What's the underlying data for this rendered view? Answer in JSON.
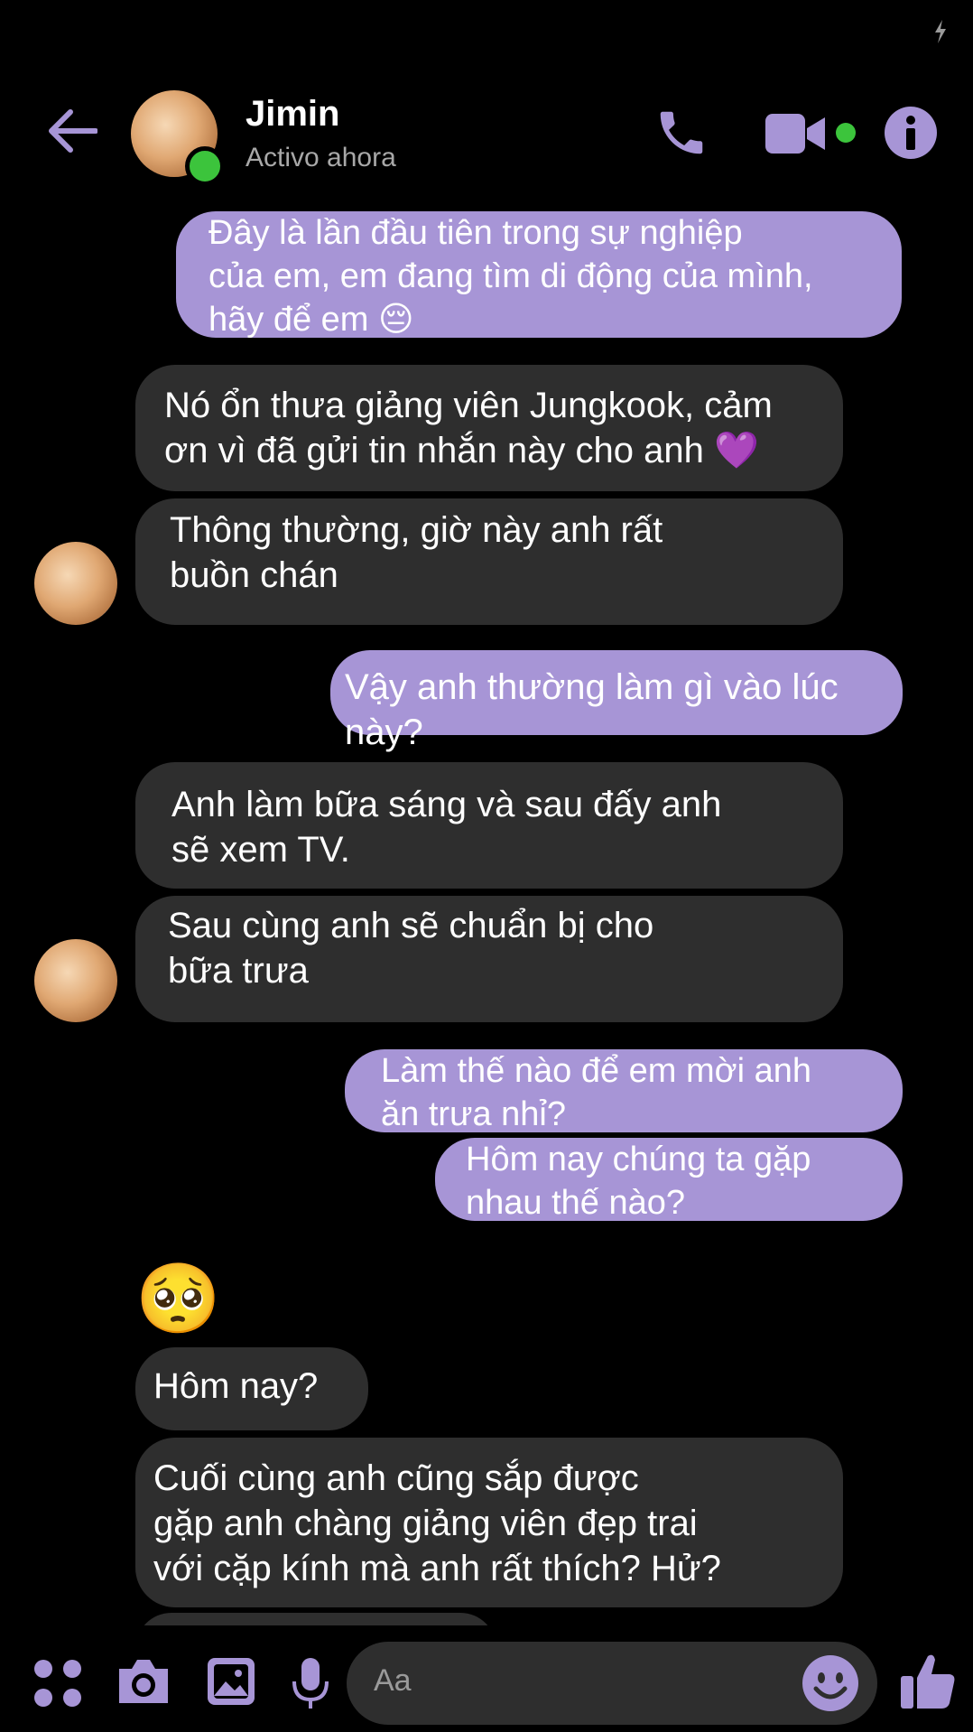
{
  "header": {
    "contact_name": "Jimin",
    "status": "Activo ahora"
  },
  "messages": [
    {
      "side": "out",
      "text": "Đây là lần đầu tiên trong sự nghiệp\ncủa em, em đang tìm di động của mình,\nhãy để em 😔"
    },
    {
      "side": "in",
      "text": "Nó ổn thưa giảng viên Jungkook, cảm\nơn vì đã gửi tin nhắn này cho anh 💜"
    },
    {
      "side": "in",
      "text": "Thông thường, giờ này anh rất\nbuồn chán"
    },
    {
      "side": "out",
      "text": "Vậy anh thường làm gì vào lúc này?"
    },
    {
      "side": "in",
      "text": "Anh làm bữa sáng và sau đấy anh\nsẽ xem TV."
    },
    {
      "side": "in",
      "text": "Sau cùng anh sẽ chuẩn bị cho\nbữa trưa"
    },
    {
      "side": "out",
      "text": "Làm thế nào để em mời anh\năn trưa nhỉ?"
    },
    {
      "side": "out",
      "text": "Hôm nay chúng ta gặp\nnhau thế nào?"
    },
    {
      "side": "in",
      "text": "🥺"
    },
    {
      "side": "in",
      "text": "Hôm nay?"
    },
    {
      "side": "in",
      "text": "Cuối cùng anh cũng sắp được\ngặp anh chàng giảng viên đẹp trai\nvới cặp kính mà anh rất thích? Hử?"
    }
  ],
  "composer": {
    "placeholder": "Aa"
  },
  "colors": {
    "accent": "#a795d6",
    "incoming_bubble": "#2e2e2e",
    "online": "#3cc43c"
  },
  "icons": [
    "back-arrow-icon",
    "phone-icon",
    "video-camera-icon",
    "info-icon",
    "apps-icon",
    "camera-icon",
    "gallery-icon",
    "microphone-icon",
    "emoji-icon",
    "thumbs-up-icon",
    "charging-icon"
  ]
}
